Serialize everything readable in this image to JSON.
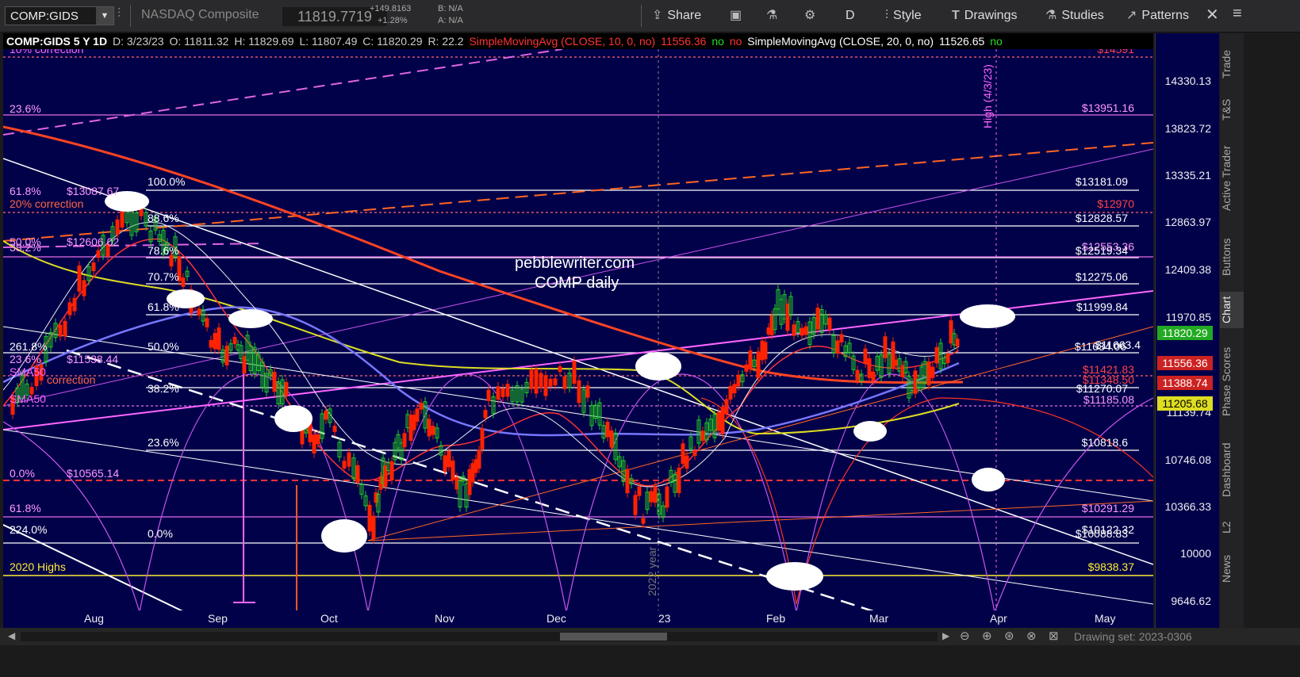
{
  "toolbar": {
    "symbol": "COMP:GIDS",
    "description": "NASDAQ Composite",
    "last": "11819.7719",
    "change": "+149.8163",
    "change_pct": "+1.28%",
    "bid": "B: N/A",
    "ask": "A: N/A",
    "share": "Share",
    "period": "D",
    "style": "Style",
    "drawings": "Drawings",
    "studies": "Studies",
    "patterns": "Patterns"
  },
  "legend": {
    "title": "COMP:GIDS 5 Y 1D",
    "date": "D: 3/23/23",
    "open": "O: 11811.32",
    "high": "H: 11829.69",
    "low": "L: 11807.49",
    "close": "C: 11820.29",
    "range": "R: 22.2",
    "sma10": "SimpleMovingAvg (CLOSE, 10, 0, no)",
    "sma10_val": "11556.36",
    "no1": "no",
    "no2": "no",
    "sma20": "SimpleMovingAvg (CLOSE, 20, 0, no)",
    "sma20_val": "11526.65",
    "no3": "no"
  },
  "yaxis": {
    "ticks": [
      "14330.13",
      "13823.72",
      "13335.21",
      "12863.97",
      "12409.38",
      "11970.85",
      "11139.74",
      "10746.08",
      "10366.33",
      "10000",
      "9646.62"
    ],
    "tag_last": "11820.29",
    "tag_sma10": "11556.36",
    "tag_red": "11388.74",
    "tag_yellow": "11205.68"
  },
  "xaxis": {
    "months": [
      "Aug",
      "Sep",
      "Oct",
      "Nov",
      "Dec",
      "23",
      "Feb",
      "Mar",
      "Apr",
      "May"
    ]
  },
  "annotations": {
    "watermark1": "pebblewriter.com",
    "watermark2": "COMP daily",
    "high_label": "High (4/3/23)",
    "year_label": "2022 year",
    "fib_100": "100.0%",
    "fib_886": "88.6%",
    "fib_786": "78.6%",
    "fib_707": "70.7%",
    "fib_618": "61.8%",
    "fib_50": "50.0%",
    "fib_382": "38.2%",
    "fib_236": "23.6%",
    "fib_0": "0.0%",
    "l_236a": "23.6%",
    "l_618a": "61.8%",
    "l_13087": "$13087.67",
    "l_20corr": "20% correction",
    "l_10corr": "10% correction",
    "l_50": "50.0%",
    "l_12606": "$12606.02",
    "l_382": "38.2%",
    "l_2618": "261.8%",
    "l_236b": "23.6%",
    "l_11538": "$11538.44",
    "l_sma50": "SMA50",
    "l_sma50b": "SMA50",
    "l_corr": "correction",
    "l_0": "0.0%",
    "l_10565": "$10565.14",
    "l_618b": "61.8%",
    "l_224": "224.0%",
    "l_2020": "2020 Highs",
    "r_14591": "$14591",
    "r_13951": "$13951.16",
    "r_13181": "$13181.09",
    "r_12970": "$12970",
    "r_12828": "$12828.57",
    "r_12553": "$12553.36",
    "r_12519": "$12519.34",
    "r_12275": "$12275.06",
    "r_11999": "$11999.84",
    "r_11634": "$11634.06",
    "r_11663": "$11663.4",
    "r_11421": "$11421.83",
    "r_11348": "$11348.50",
    "r_11270": "$11270.07",
    "r_11185": "$11185.08",
    "r_10818": "$10818.6",
    "r_10291": "$10291.29",
    "r_10122": "$10122.32",
    "r_10088": "$10088.83",
    "r_9838": "$9838.37"
  },
  "side_tabs": [
    "Trade",
    "T&S",
    "Active Trader",
    "Buttons",
    "Chart",
    "Phase Scores",
    "Dashboard",
    "L2",
    "News"
  ],
  "bottom": {
    "drawing_set": "Drawing set: 2023-0306"
  }
}
